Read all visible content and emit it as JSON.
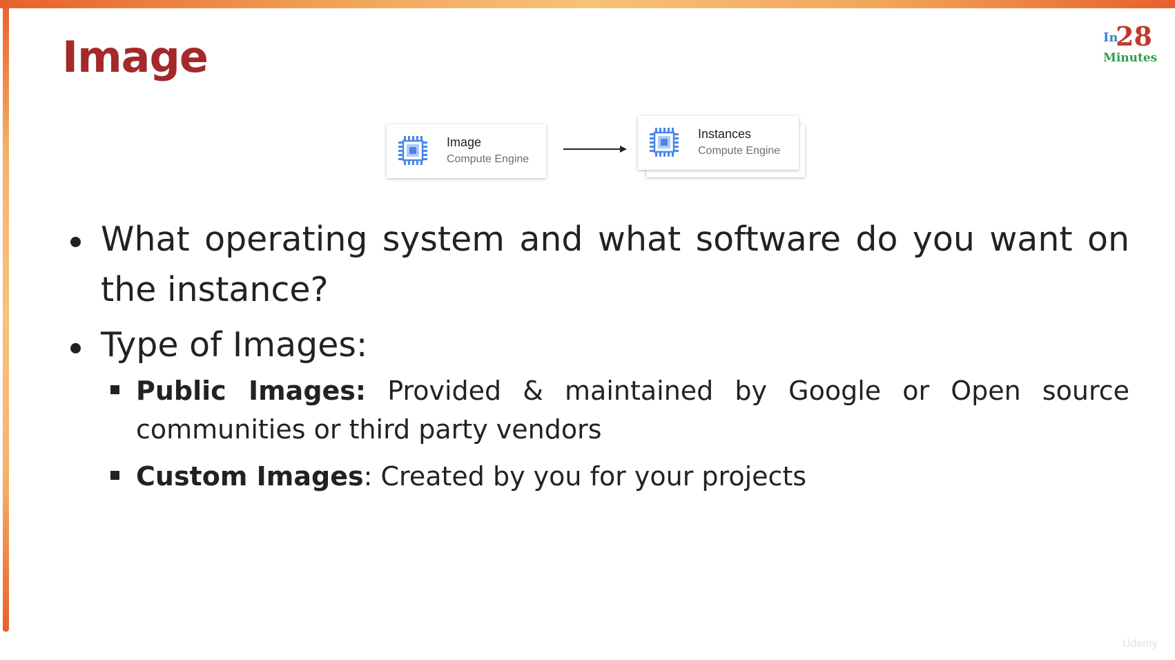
{
  "slide": {
    "title": "Image",
    "logo": {
      "prefix": "In",
      "number": "28",
      "suffix": "Minutes"
    },
    "diagram": {
      "source": {
        "name": "Image",
        "service": "Compute Engine",
        "icon": "compute-engine-chip-icon"
      },
      "target": {
        "name": "Instances",
        "service": "Compute Engine",
        "icon": "compute-engine-chip-icon"
      },
      "connector": "arrow-right-icon"
    },
    "bullets": [
      {
        "text": "What operating system and what software do you want on the instance?"
      },
      {
        "text": "Type of Images:",
        "sub_items": [
          {
            "term": "Public Images",
            "separator": ":",
            "description": " Provided & maintained by Google or Open source communities or third party vendors"
          },
          {
            "term": "Custom Images",
            "separator": ":",
            "description": " Created by you for your projects"
          }
        ]
      }
    ],
    "watermark": "Udemy"
  },
  "colors": {
    "title": "#a3292c",
    "chip_icon": "#4a86e8",
    "border_accent": "#e8602c"
  }
}
